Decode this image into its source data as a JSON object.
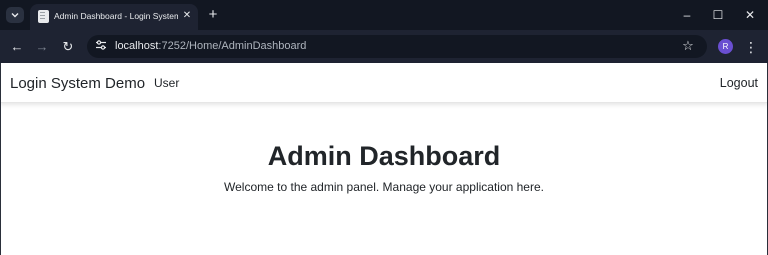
{
  "browser": {
    "tab": {
      "title": "Admin Dashboard - Login System Demo",
      "close_glyph": "✕"
    },
    "new_tab_glyph": "+",
    "window_controls": {
      "minimize": "–",
      "maximize": "☐",
      "close": "✕"
    },
    "nav": {
      "back": "←",
      "forward": "→",
      "reload": "↻"
    },
    "address": {
      "host": "localhost",
      "rest": ":7252/Home/AdminDashboard"
    },
    "bookmark_glyph": "☆",
    "profile_initial": "R",
    "menu_glyph": "⋮",
    "icons": {
      "tab_search": "chevron-down-icon",
      "site_info": "tune-icon",
      "bookmark": "star-icon",
      "menu": "more-vert-icon"
    }
  },
  "app": {
    "brand": "Login System Demo",
    "nav_user": "User",
    "logout": "Logout",
    "title": "Admin Dashboard",
    "subtitle": "Welcome to the admin panel. Manage your application here."
  },
  "colors": {
    "chrome_bg": "#1e2332",
    "tabstrip_bg": "#121722",
    "profile_bg": "#6a4fd1",
    "page_bg": "#ffffff",
    "text": "#212529"
  }
}
